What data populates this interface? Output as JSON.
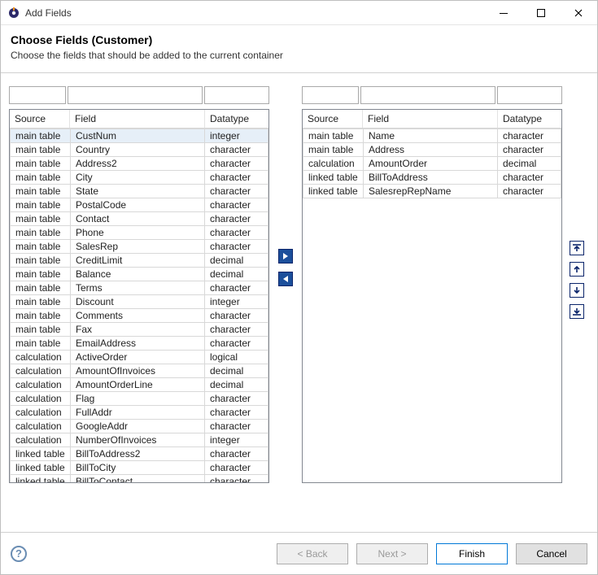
{
  "window": {
    "title": "Add Fields"
  },
  "header": {
    "title": "Choose Fields (Customer)",
    "subtitle": "Choose the fields that should be added to the current container"
  },
  "columns": {
    "source": "Source",
    "field": "Field",
    "datatype": "Datatype"
  },
  "left_filters": {
    "source": "",
    "field": "",
    "datatype": ""
  },
  "right_filters": {
    "source": "",
    "field": "",
    "datatype": ""
  },
  "available_selected_index": 0,
  "available": [
    {
      "source": "main table",
      "field": "CustNum",
      "datatype": "integer"
    },
    {
      "source": "main table",
      "field": "Country",
      "datatype": "character"
    },
    {
      "source": "main table",
      "field": "Address2",
      "datatype": "character"
    },
    {
      "source": "main table",
      "field": "City",
      "datatype": "character"
    },
    {
      "source": "main table",
      "field": "State",
      "datatype": "character"
    },
    {
      "source": "main table",
      "field": "PostalCode",
      "datatype": "character"
    },
    {
      "source": "main table",
      "field": "Contact",
      "datatype": "character"
    },
    {
      "source": "main table",
      "field": "Phone",
      "datatype": "character"
    },
    {
      "source": "main table",
      "field": "SalesRep",
      "datatype": "character"
    },
    {
      "source": "main table",
      "field": "CreditLimit",
      "datatype": "decimal"
    },
    {
      "source": "main table",
      "field": "Balance",
      "datatype": "decimal"
    },
    {
      "source": "main table",
      "field": "Terms",
      "datatype": "character"
    },
    {
      "source": "main table",
      "field": "Discount",
      "datatype": "integer"
    },
    {
      "source": "main table",
      "field": "Comments",
      "datatype": "character"
    },
    {
      "source": "main table",
      "field": "Fax",
      "datatype": "character"
    },
    {
      "source": "main table",
      "field": "EmailAddress",
      "datatype": "character"
    },
    {
      "source": "calculation",
      "field": "ActiveOrder",
      "datatype": "logical"
    },
    {
      "source": "calculation",
      "field": "AmountOfInvoices",
      "datatype": "decimal"
    },
    {
      "source": "calculation",
      "field": "AmountOrderLine",
      "datatype": "decimal"
    },
    {
      "source": "calculation",
      "field": "Flag",
      "datatype": "character"
    },
    {
      "source": "calculation",
      "field": "FullAddr",
      "datatype": "character"
    },
    {
      "source": "calculation",
      "field": "GoogleAddr",
      "datatype": "character"
    },
    {
      "source": "calculation",
      "field": "NumberOfInvoices",
      "datatype": "integer"
    },
    {
      "source": "linked table",
      "field": "BillToAddress2",
      "datatype": "character"
    },
    {
      "source": "linked table",
      "field": "BillToCity",
      "datatype": "character"
    },
    {
      "source": "linked table",
      "field": "BillToContact",
      "datatype": "character"
    }
  ],
  "selected": [
    {
      "source": "main table",
      "field": "Name",
      "datatype": "character"
    },
    {
      "source": "main table",
      "field": "Address",
      "datatype": "character"
    },
    {
      "source": "calculation",
      "field": "AmountOrder",
      "datatype": "decimal"
    },
    {
      "source": "linked table",
      "field": "BillToAddress",
      "datatype": "character"
    },
    {
      "source": "linked table",
      "field": "SalesrepRepName",
      "datatype": "character"
    }
  ],
  "buttons": {
    "back": "< Back",
    "next": "Next >",
    "finish": "Finish",
    "cancel": "Cancel"
  }
}
